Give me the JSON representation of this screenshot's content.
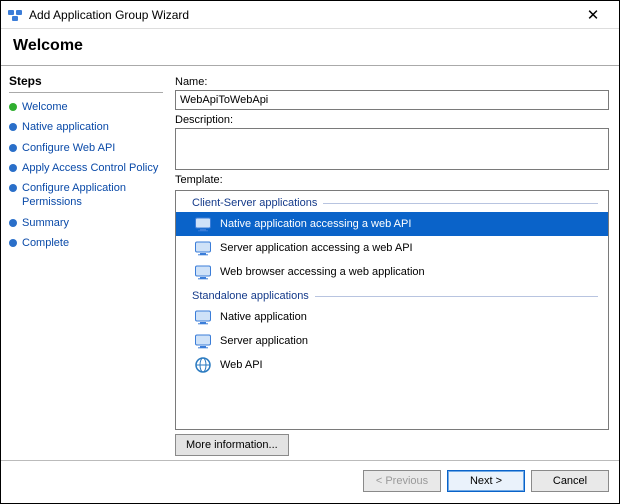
{
  "window": {
    "title": "Add Application Group Wizard",
    "close_label": "✕"
  },
  "banner": {
    "heading": "Welcome"
  },
  "sidebar": {
    "title": "Steps",
    "items": [
      {
        "label": "Welcome",
        "state": "current"
      },
      {
        "label": "Native application",
        "state": "future"
      },
      {
        "label": "Configure Web API",
        "state": "future"
      },
      {
        "label": "Apply Access Control Policy",
        "state": "future"
      },
      {
        "label": "Configure Application Permissions",
        "state": "future"
      },
      {
        "label": "Summary",
        "state": "future"
      },
      {
        "label": "Complete",
        "state": "future"
      }
    ]
  },
  "form": {
    "name_label": "Name:",
    "name_value": "WebApiToWebApi",
    "description_label": "Description:",
    "description_value": "",
    "template_label": "Template:",
    "groups": [
      {
        "header": "Client-Server applications",
        "items": [
          {
            "label": "Native application accessing a web API",
            "icon": "native-webapi-icon",
            "selected": true
          },
          {
            "label": "Server application accessing a web API",
            "icon": "server-webapi-icon",
            "selected": false
          },
          {
            "label": "Web browser accessing a web application",
            "icon": "browser-webapp-icon",
            "selected": false
          }
        ]
      },
      {
        "header": "Standalone applications",
        "items": [
          {
            "label": "Native application",
            "icon": "native-app-icon",
            "selected": false
          },
          {
            "label": "Server application",
            "icon": "server-app-icon",
            "selected": false
          },
          {
            "label": "Web API",
            "icon": "webapi-icon",
            "selected": false
          }
        ]
      }
    ],
    "more_info_label": "More information..."
  },
  "footer": {
    "previous_label": "< Previous",
    "next_label": "Next >",
    "cancel_label": "Cancel"
  }
}
